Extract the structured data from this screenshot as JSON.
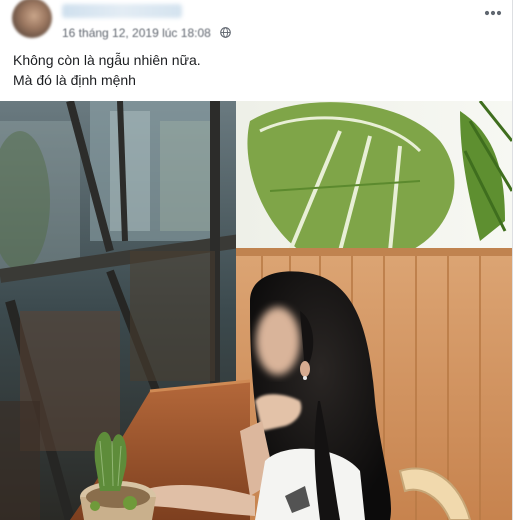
{
  "post": {
    "timestamp": "16 tháng 12, 2019 lúc 18:08",
    "privacy_icon": "globe-icon",
    "menu_icon": "more-horizontal-icon",
    "text_lines": [
      "Không còn là ngẫu nhiên nữa.",
      "Mà đó là định mệnh"
    ],
    "photo": {
      "description_icon": "photo-image"
    }
  },
  "colors": {
    "text_primary": "#1c1e21",
    "text_secondary": "#616770",
    "wood": "#d59a63",
    "leaf": "#6f9a3a"
  }
}
